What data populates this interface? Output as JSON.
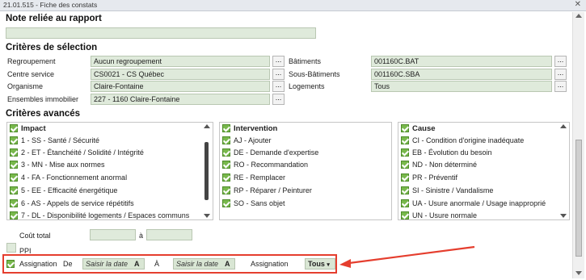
{
  "window": {
    "title": "21.01.515 - Fiche des constats"
  },
  "note": {
    "heading": "Note reliée au rapport",
    "value": ""
  },
  "selection": {
    "heading": "Critères de sélection",
    "regroupement": {
      "label": "Regroupement",
      "value": "Aucun regroupement"
    },
    "centre": {
      "label": "Centre service",
      "value": "CS0021 - CS Québec"
    },
    "organisme": {
      "label": "Organisme",
      "value": "Claire-Fontaine"
    },
    "ensembles": {
      "label": "Ensembles immobilier",
      "value": "227 - 1160 Claire-Fontaine"
    },
    "batiments": {
      "label": "Bâtiments",
      "value": "001160C.BAT"
    },
    "sousbatiments": {
      "label": "Sous-Bâtiments",
      "value": "001160C.SBA"
    },
    "logements": {
      "label": "Logements",
      "value": "Tous"
    },
    "dots": "..."
  },
  "avances": {
    "heading": "Critères avancés",
    "impact": {
      "header": "Impact",
      "items": [
        "1 - SS - Santé / Sécurité",
        "2 - ET - Étanchéité / Solidité / Intégrité",
        "3 - MN - Mise aux normes",
        "4 - FA - Fonctionnement anormal",
        "5 - EE - Efficacité énergétique",
        "6 - AS - Appels de service répétitifs",
        "7 - DL - Disponibilité logements / Espaces communs"
      ]
    },
    "intervention": {
      "header": "Intervention",
      "items": [
        "AJ - Ajouter",
        "DE - Demande d'expertise",
        "RO - Recommandation",
        "RE - Remplacer",
        "RP - Réparer / Peinturer",
        "SO - Sans objet"
      ]
    },
    "cause": {
      "header": "Cause",
      "items": [
        "CI - Condition d'origine inadéquate",
        "EB - Évolution du besoin",
        "ND - Non déterminé",
        "PR - Préventif",
        "SI - Sinistre / Vandalisme",
        "UA - Usure anormale / Usage inapproprié",
        "UN - Usure normale"
      ]
    }
  },
  "cout": {
    "label": "Coût total",
    "separator": "à",
    "from": "",
    "to": ""
  },
  "ppi": {
    "label": "PPI"
  },
  "assignation": {
    "label": "Assignation",
    "de": "De",
    "date_placeholder": "Saisir la date",
    "date_suffix": "A",
    "a": "À",
    "label2": "Assignation",
    "select_value": "Tous"
  },
  "colors": {
    "accent_green": "#78b84c",
    "field_bg": "#dfeadb",
    "highlight_red": "#e53e2e"
  }
}
